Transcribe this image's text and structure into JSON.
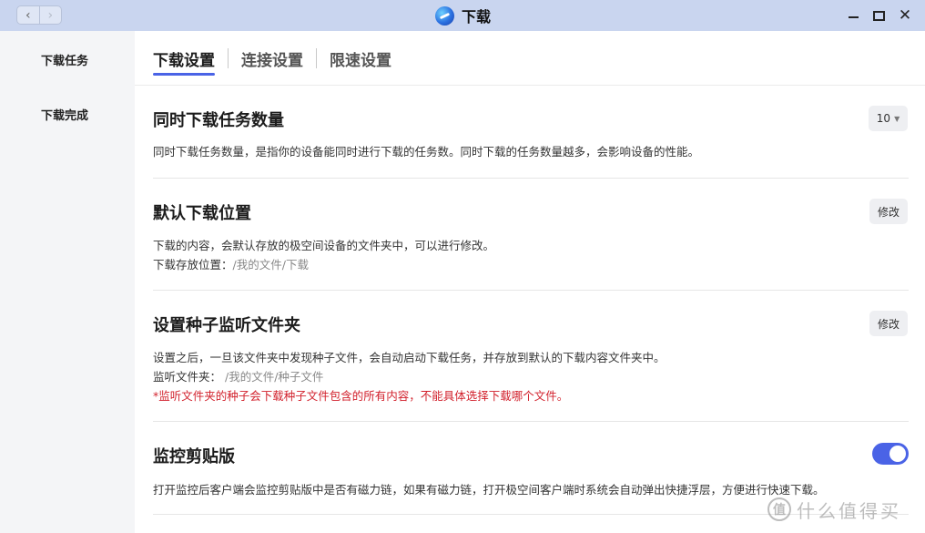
{
  "window": {
    "title": "下载",
    "back_icon": "‹",
    "forward_icon": "›",
    "close_icon": "✕"
  },
  "sidebar": {
    "items": [
      {
        "label": "下载任务"
      },
      {
        "label": "下载完成"
      }
    ]
  },
  "tabs": [
    {
      "label": "下载设置",
      "active": true
    },
    {
      "label": "连接设置",
      "active": false
    },
    {
      "label": "限速设置",
      "active": false
    }
  ],
  "sections": {
    "concurrent": {
      "title": "同时下载任务数量",
      "selected_value": "10",
      "description": "同时下载任务数量，是指你的设备能同时进行下载的任务数。同时下载的任务数量越多，会影响设备的性能。"
    },
    "default_location": {
      "title": "默认下载位置",
      "button_label": "修改",
      "description": "下载的内容，会默认存放的极空间设备的文件夹中，可以进行修改。",
      "path_label": "下载存放位置：",
      "path_value": "/我的文件/下载"
    },
    "torrent_watch": {
      "title": "设置种子监听文件夹",
      "button_label": "修改",
      "description": "设置之后，一旦该文件夹中发现种子文件，会自动启动下载任务，并存放到默认的下载内容文件夹中。",
      "path_label": "监听文件夹： ",
      "path_value": "/我的文件/种子文件",
      "warning": "*监听文件夹的种子会下载种子文件包含的所有内容，不能具体选择下载哪个文件。"
    },
    "clipboard": {
      "title": "监控剪贴版",
      "enabled": true,
      "description": "打开监控后客户端会监控剪贴版中是否有磁力链，如果有磁力链，打开极空间客户端时系统会自动弹出快捷浮层，方便进行快速下载。"
    }
  },
  "watermark": {
    "logo": "值",
    "text": "什么值得买"
  },
  "colors": {
    "titlebar": "#c9d5ef",
    "accent": "#4a63e6",
    "warning": "#d2222d",
    "sidebar": "#f4f5f7"
  }
}
